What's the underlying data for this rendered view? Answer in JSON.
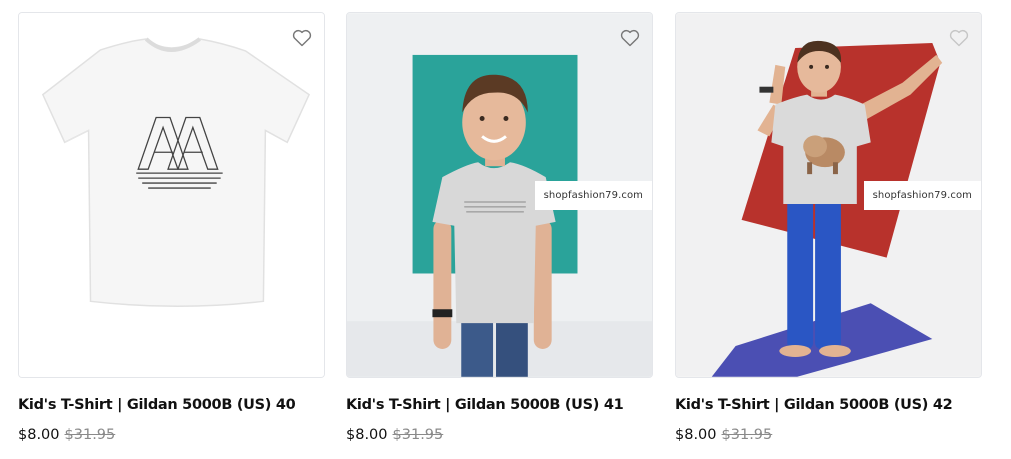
{
  "products": [
    {
      "title": "Kid's T-Shirt | Gildan 5000B (US) 40",
      "price": "$8.00",
      "original_price": "$31.95",
      "image_icon": "white-tshirt-aa-print",
      "watermark": ""
    },
    {
      "title": "Kid's T-Shirt | Gildan 5000B (US) 41",
      "price": "$8.00",
      "original_price": "$31.95",
      "image_icon": "boy-grey-tshirt-teal-backdrop",
      "watermark": "shopfashion79.com"
    },
    {
      "title": "Kid's T-Shirt | Gildan 5000B (US) 42",
      "price": "$8.00",
      "original_price": "$31.95",
      "image_icon": "boy-grey-tshirt-red-backdrop",
      "watermark": "shopfashion79.com"
    }
  ],
  "wishlist_icon": "heart-outline-icon",
  "colors": {
    "teal": "#2aa39a",
    "red": "#b8322c",
    "mat": "#4b4fb3",
    "text": "#111111",
    "strike": "#8a8a8a"
  }
}
